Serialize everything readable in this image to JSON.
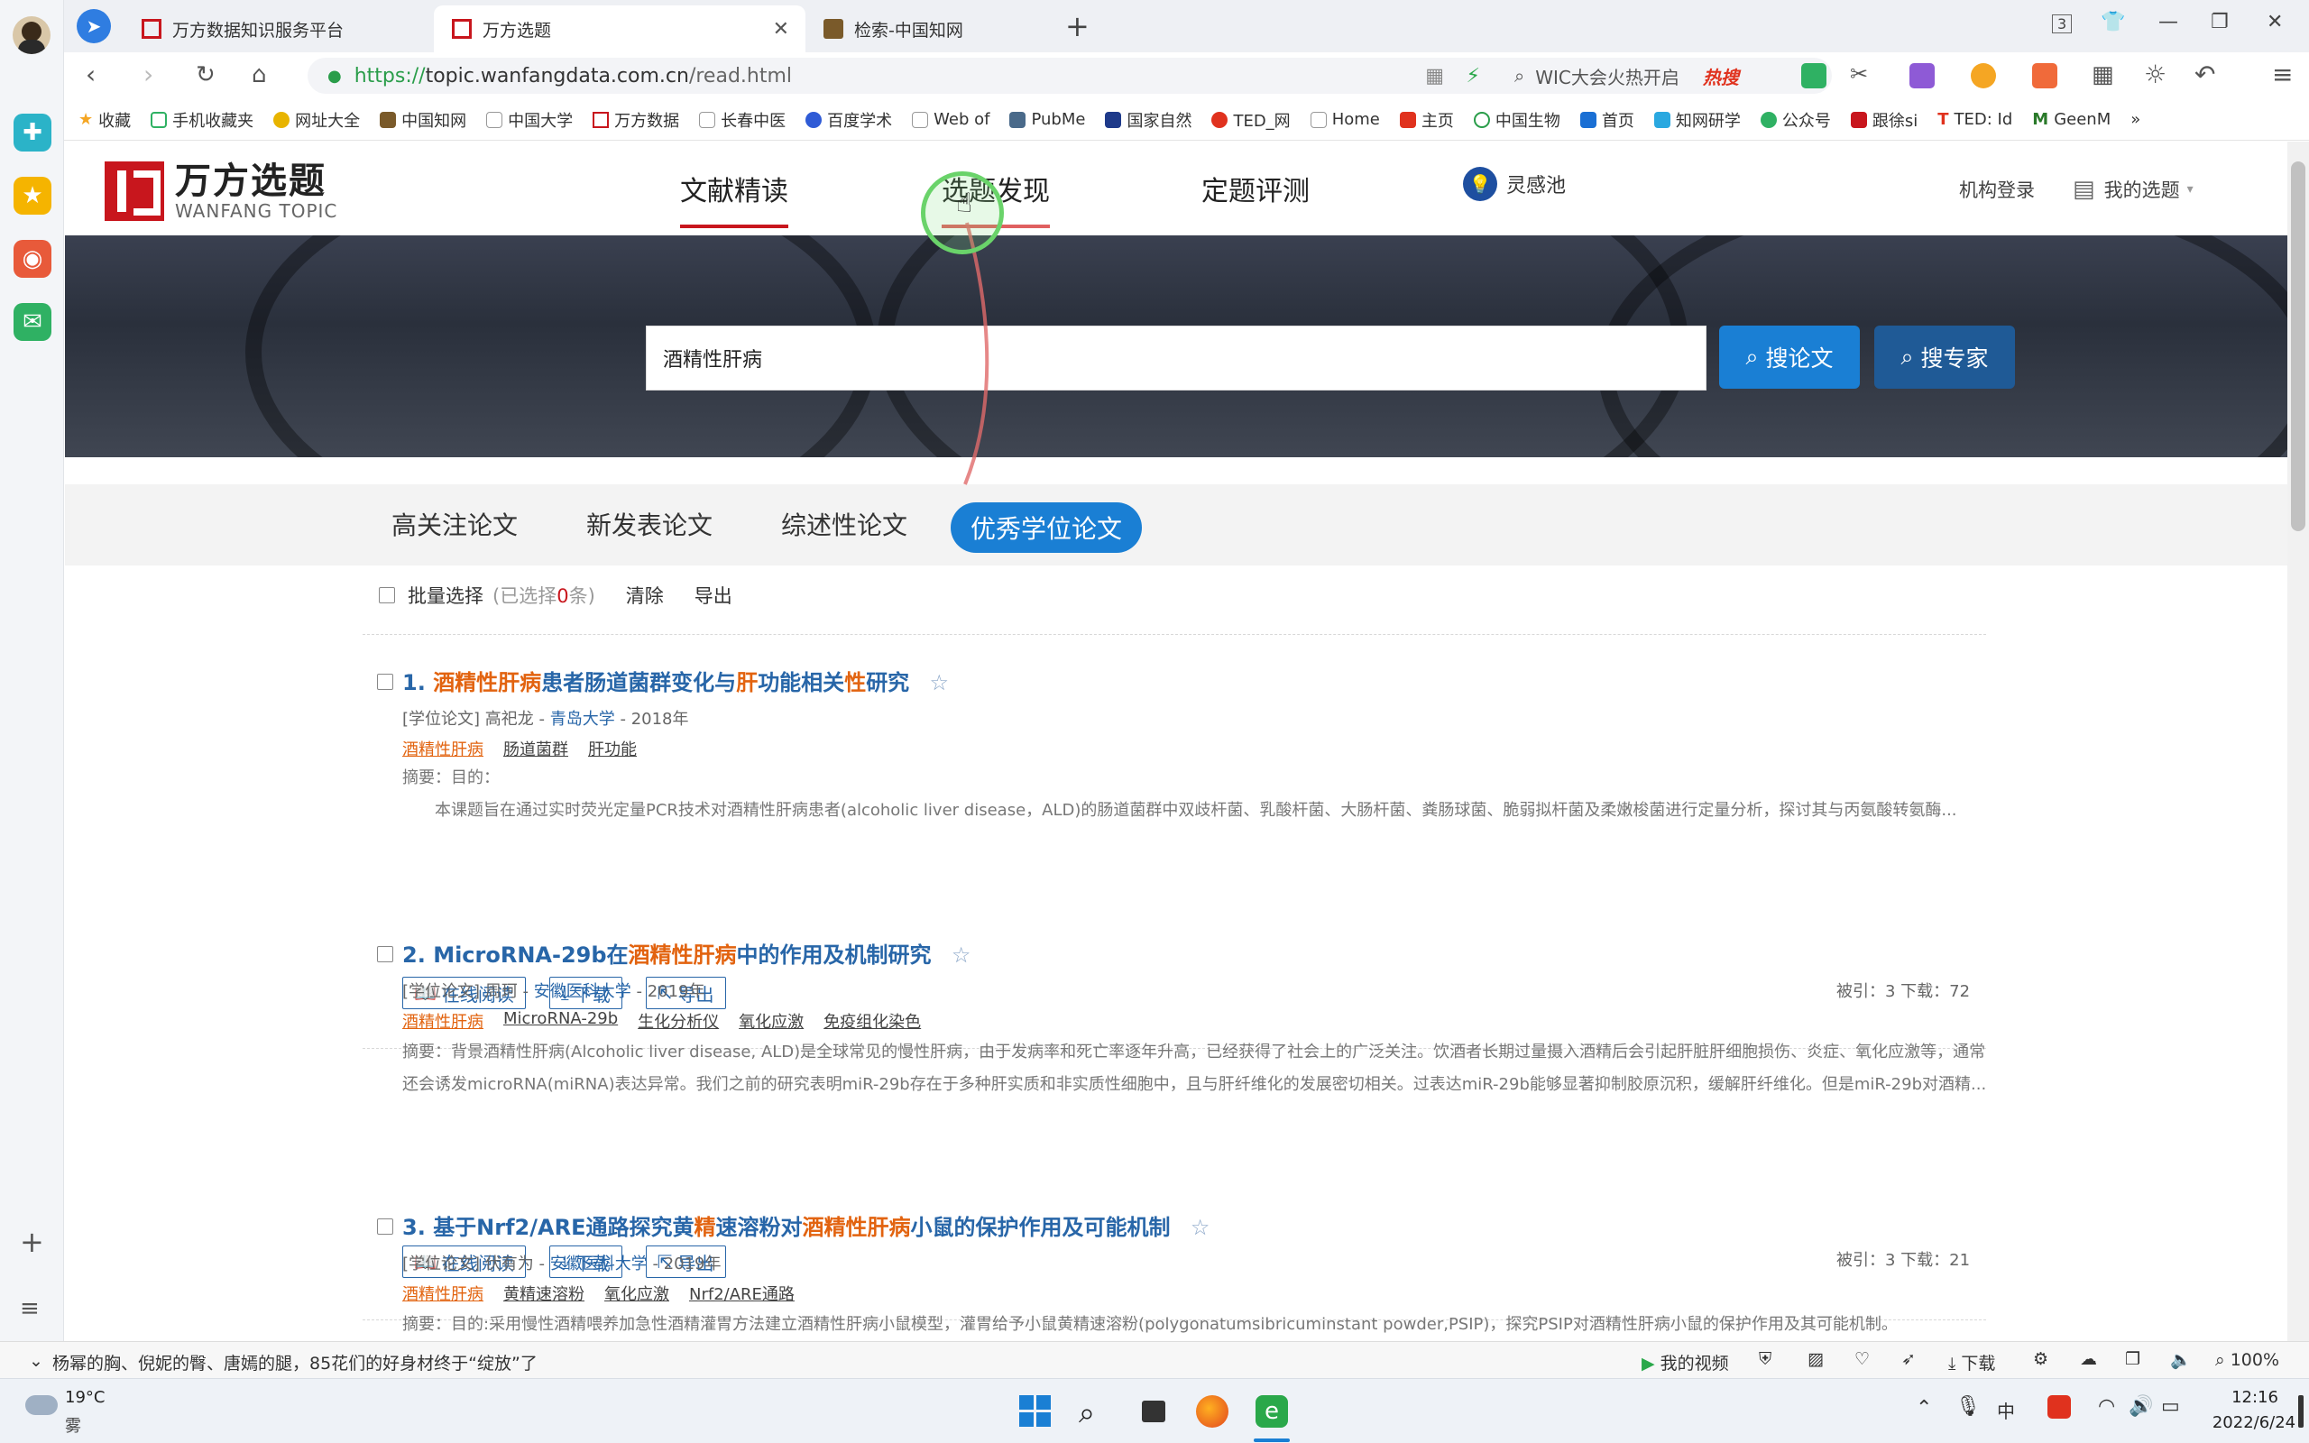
{
  "browser": {
    "tabs": [
      {
        "title": "万方数据知识服务平台",
        "active": false
      },
      {
        "title": "万方选题",
        "active": true
      },
      {
        "title": "检索-中国知网",
        "active": false
      }
    ],
    "tab_count_badge": "3",
    "url_prefix": "https://",
    "url_host": "topic.wanfangdata.com.cn",
    "url_path": "/read.html",
    "search_hint": "WIC大会火热开启",
    "hot_label": "热搜",
    "bookmarks": [
      "收藏",
      "手机收藏夹",
      "网址大全",
      "中国知网",
      "中国大学",
      "万方数据",
      "长春中医",
      "百度学术",
      "Web of",
      "PubMe",
      "国家自然",
      "TED_网",
      "Home",
      "主页",
      "中国生物",
      "首页",
      "知网研学",
      "公众号",
      "跟徐si",
      "TED: Id",
      "GeenM"
    ],
    "more_bookmarks": "»"
  },
  "site": {
    "logo_cn": "万方选题",
    "logo_en": "WANFANG TOPIC",
    "nav": [
      "文献精读",
      "选题发现",
      "定题评测"
    ],
    "inspire": "灵感池",
    "login": "机构登录",
    "my_topics": "我的选题"
  },
  "search": {
    "value": "酒精性肝病",
    "btn_papers": "搜论文",
    "btn_experts": "搜专家"
  },
  "subtabs": [
    "高关注论文",
    "新发表论文",
    "综述性论文",
    "优秀学位论文"
  ],
  "toolbar": {
    "batch": "批量选择",
    "selected_prefix": "(已选择",
    "selected_count": "0",
    "selected_suffix": "条)",
    "clear": "清除",
    "export": "导出"
  },
  "actions": {
    "read": "在线阅读",
    "download": "下载",
    "export": "导出"
  },
  "results": [
    {
      "num": "1.",
      "title_parts": [
        {
          "t": "酒精性肝病",
          "hl": true
        },
        {
          "t": "患者肠道菌群变化与",
          "hl": false
        },
        {
          "t": "肝",
          "hl": true
        },
        {
          "t": "功能相关",
          "hl": false
        },
        {
          "t": "性",
          "hl": true
        },
        {
          "t": "研究",
          "hl": false
        }
      ],
      "meta_type": "[学位论文]",
      "author": "高祀龙",
      "school": "青岛大学",
      "year": "2018年",
      "keywords": [
        "酒精性肝病",
        "肠道菌群",
        "肝功能"
      ],
      "abstract_label": "摘要：目的：",
      "abstract": "本课题旨在通过实时荧光定量PCR技术对酒精性肝病患者(alcoholic liver disease，ALD)的肠道菌群中双歧杆菌、乳酸杆菌、大肠杆菌、粪肠球菌、脆弱拟杆菌及柔嫩梭菌进行定量分析，探讨其与丙氨酸转氨酶...",
      "stats": "被引：3   下载：72"
    },
    {
      "num": "2.",
      "title_parts": [
        {
          "t": "MicroRNA-29b在",
          "hl": false
        },
        {
          "t": "酒精性肝病",
          "hl": true
        },
        {
          "t": "中的作用及机制研究",
          "hl": false
        }
      ],
      "meta_type": "[学位论文]",
      "author": "周珂",
      "school": "安徽医科大学",
      "year": "2019年",
      "keywords": [
        "酒精性肝病",
        "MicroRNA-29b",
        "生化分析仪",
        "氧化应激",
        "免疫组化染色"
      ],
      "abstract_label": "",
      "abstract": "摘要：背景酒精性肝病(Alcoholic liver disease, ALD)是全球常见的慢性肝病，由于发病率和死亡率逐年升高，已经获得了社会上的广泛关注。饮酒者长期过量摄入酒精后会引起肝脏肝细胞损伤、炎症、氧化应激等，通常还会诱发microRNA(miRNA)表达异常。我们之前的研究表明miR-29b存在于多种肝实质和非实质性细胞中，且与肝纤维化的发展密切相关。过表达miR-29b能够显著抑制胶原沉积，缓解肝纤维化。但是miR-29b对酒精...",
      "stats": "被引：3   下载：21"
    },
    {
      "num": "3.",
      "title_parts": [
        {
          "t": "基于Nrf2/ARE通路探究黄",
          "hl": false
        },
        {
          "t": "精",
          "hl": true
        },
        {
          "t": "速溶粉对",
          "hl": false
        },
        {
          "t": "酒精性肝病",
          "hl": true
        },
        {
          "t": "小鼠的保护作用及可能机制",
          "hl": false
        }
      ],
      "meta_type": "[学位论文]",
      "author": "伏有为",
      "school": "安徽医科大学",
      "year": "2019年",
      "keywords": [
        "酒精性肝病",
        "黄精速溶粉",
        "氧化应激",
        "Nrf2/ARE通路"
      ],
      "abstract_label": "",
      "abstract": "摘要：目的:采用慢性酒精喂养加急性酒精灌胃方法建立酒精性肝病小鼠模型，灌胃给予小鼠黄精速溶粉(polygonatumsibricuminstant powder,PSIP)，探究PSIP对酒精性肝病小鼠的保护作用及其可能机制。",
      "stats": ""
    }
  ],
  "status": {
    "news": "杨幂的胸、倪妮的臀、唐嫣的腿，85花们的好身材终于“绽放”了",
    "video": "我的视频",
    "download": "下载",
    "zoom": "100%"
  },
  "taskbar": {
    "temp": "19°C",
    "weather": "雾",
    "time": "12:16",
    "date": "2022/6/24",
    "ime": "中"
  }
}
